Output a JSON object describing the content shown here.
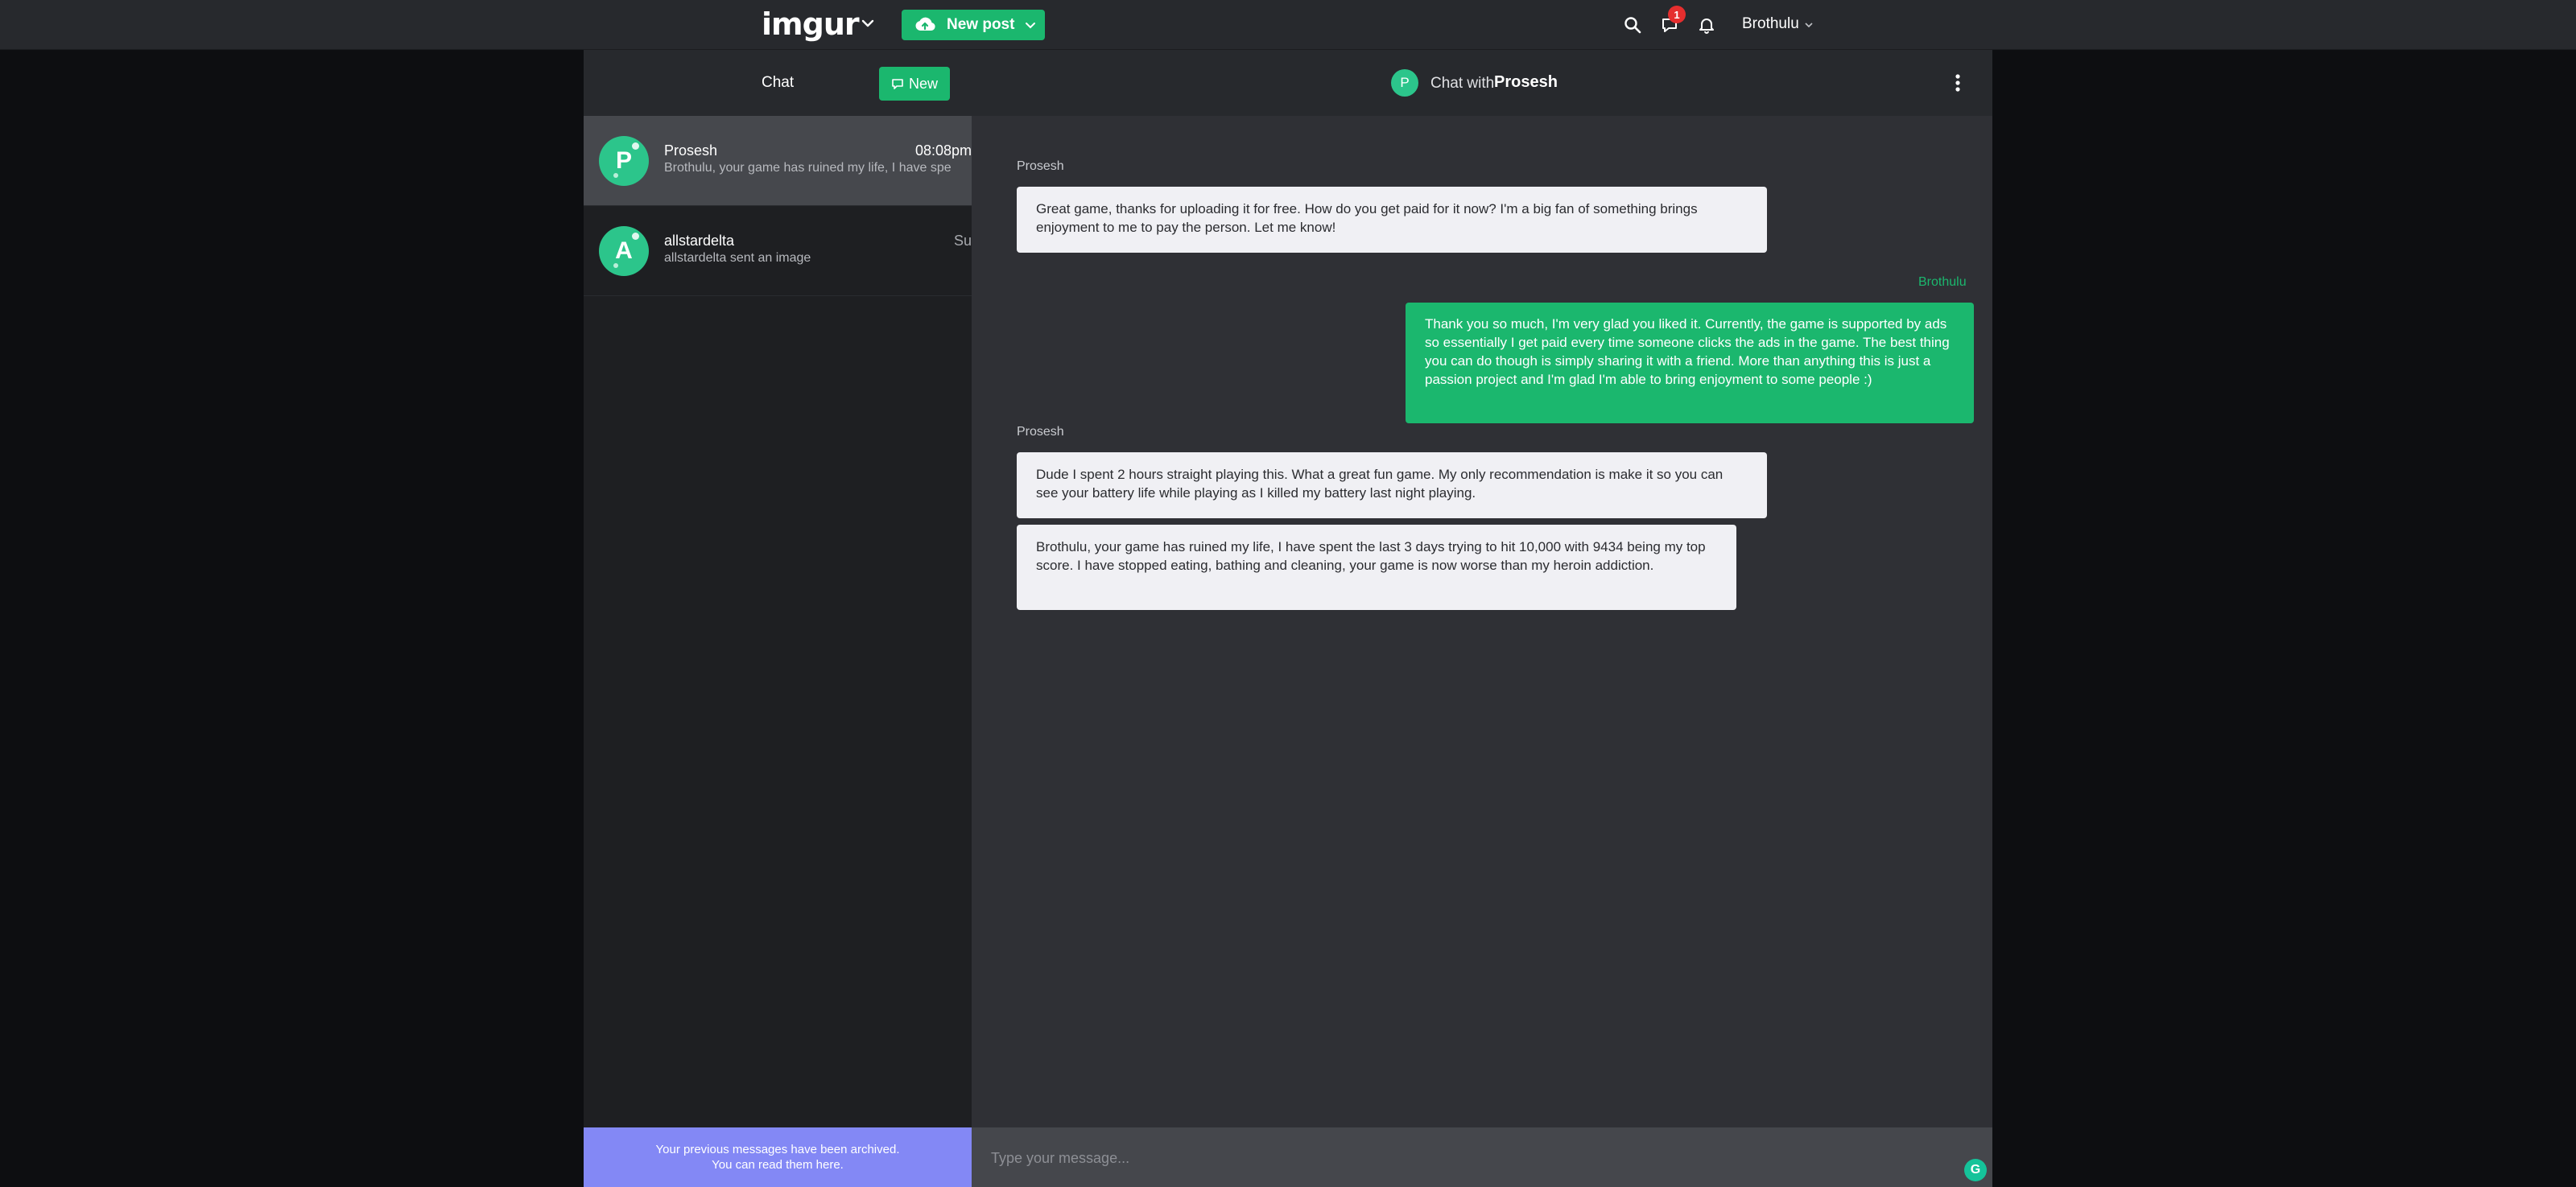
{
  "topbar": {
    "logo": "imgur",
    "new_post_label": "New post",
    "notification_badge": "1",
    "username": "Brothulu"
  },
  "sidebar": {
    "title": "Chat",
    "new_button_label": "New",
    "conversations": [
      {
        "name": "Prosesh",
        "time": "08:08pm",
        "preview": "Brothulu, your game has ruined my life, I have spe",
        "avatar_letter": "P",
        "active": true
      },
      {
        "name": "allstardelta",
        "time": "Sur",
        "preview": "allstardelta sent an image",
        "avatar_letter": "A",
        "active": false
      }
    ],
    "archived_line1": "Your previous messages have been archived.",
    "archived_line2": "You can read them here."
  },
  "chat": {
    "header_label": "Chat with",
    "header_name": "Prosesh",
    "header_avatar_letter": "P",
    "messages": [
      {
        "sender": "Prosesh",
        "text": "Great game, thanks for uploading it for free. How do you get paid for it now? I'm a big fan of something brings enjoyment to me to pay the person. Let me know!"
      },
      {
        "sender": "Brothulu",
        "text": "Thank you so much, I'm very glad you liked it. Currently, the game is supported by ads so essentially I get paid every time someone clicks the ads in the game. The best thing you can do though is simply sharing it with a friend. More than anything this is just a passion project and I'm glad I'm able to bring enjoyment to some people :)"
      },
      {
        "sender": "Prosesh",
        "text": "Dude I spent 2 hours straight playing this. What a great fun game. My only recommendation is make it so you can see your battery life while playing as I killed my battery last night playing."
      },
      {
        "sender": "",
        "text": "Brothulu, your game has ruined my life, I have spent the last 3 days trying to hit 10,000 with 9434 being my top score. I have stopped eating, bathing and cleaning, your game is now worse than my heroin addiction."
      }
    ],
    "composer_placeholder": "Type your message..."
  },
  "colors": {
    "brand_green": "#1bb76e",
    "avatar_green": "#2cc58b",
    "archive_banner": "#8388f5",
    "badge_red": "#e52e2e"
  },
  "icons": [
    "chevron-down-icon",
    "cloud-upload-icon",
    "search-icon",
    "chat-bubble-icon",
    "bell-icon",
    "kebab-menu-icon",
    "grammarly-icon"
  ]
}
